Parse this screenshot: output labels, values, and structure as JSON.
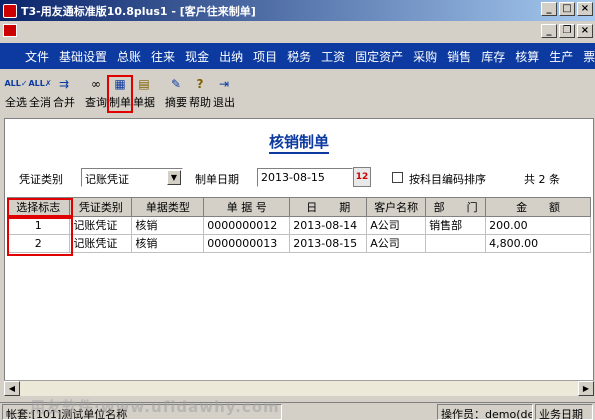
{
  "window": {
    "title": "T3-用友通标准版10.8plus1 - [客户往来制单]"
  },
  "menu": [
    "文件",
    "基础设置",
    "总账",
    "往来",
    "现金",
    "出纳",
    "项目",
    "税务",
    "工资",
    "固定资产",
    "采购",
    "销售",
    "库存",
    "核算",
    "生产",
    "票据"
  ],
  "toolbar": {
    "buttons": [
      {
        "label": "全选",
        "icon": "select-all-icon"
      },
      {
        "label": "全消",
        "icon": "deselect-all-icon"
      },
      {
        "label": "合并",
        "icon": "merge-icon"
      },
      {
        "label": "查询",
        "icon": "binoculars-icon"
      },
      {
        "label": "制单",
        "icon": "voucher-icon"
      },
      {
        "label": "单据",
        "icon": "document-icon"
      },
      {
        "label": "摘要",
        "icon": "summary-icon"
      },
      {
        "label": "帮助",
        "icon": "help-icon"
      },
      {
        "label": "退出",
        "icon": "exit-icon"
      }
    ]
  },
  "form": {
    "title": "核销制单",
    "voucher_type_label": "凭证类别",
    "voucher_type_value": "记账凭证",
    "date_label": "制单日期",
    "date_value": "2013-08-15",
    "sort_checkbox_label": "按科目编码排序",
    "count_text": "共 2 条"
  },
  "table": {
    "columns": [
      "选择标志",
      "凭证类别",
      "单据类型",
      "单 据 号",
      "日　　期",
      "客户名称",
      "部　　门",
      "金　　额"
    ],
    "rows": [
      [
        "1",
        "记账凭证",
        "核销",
        "0000000012",
        "2013-08-14",
        "A公司",
        "销售部",
        "200.00"
      ],
      [
        "2",
        "记账凭证",
        "核销",
        "0000000013",
        "2013-08-15",
        "A公司",
        "",
        "4,800.00"
      ]
    ]
  },
  "status": {
    "left": "帐套:[101]测试单位名称",
    "operator": "操作员：demo(de",
    "business": "业务日期"
  },
  "watermark": "用友软件·www.ufidawhy.com",
  "colors": {
    "menu_bg": "#0c3aa0",
    "highlight": "#e00000",
    "title_blue": "#0c3aa0"
  }
}
